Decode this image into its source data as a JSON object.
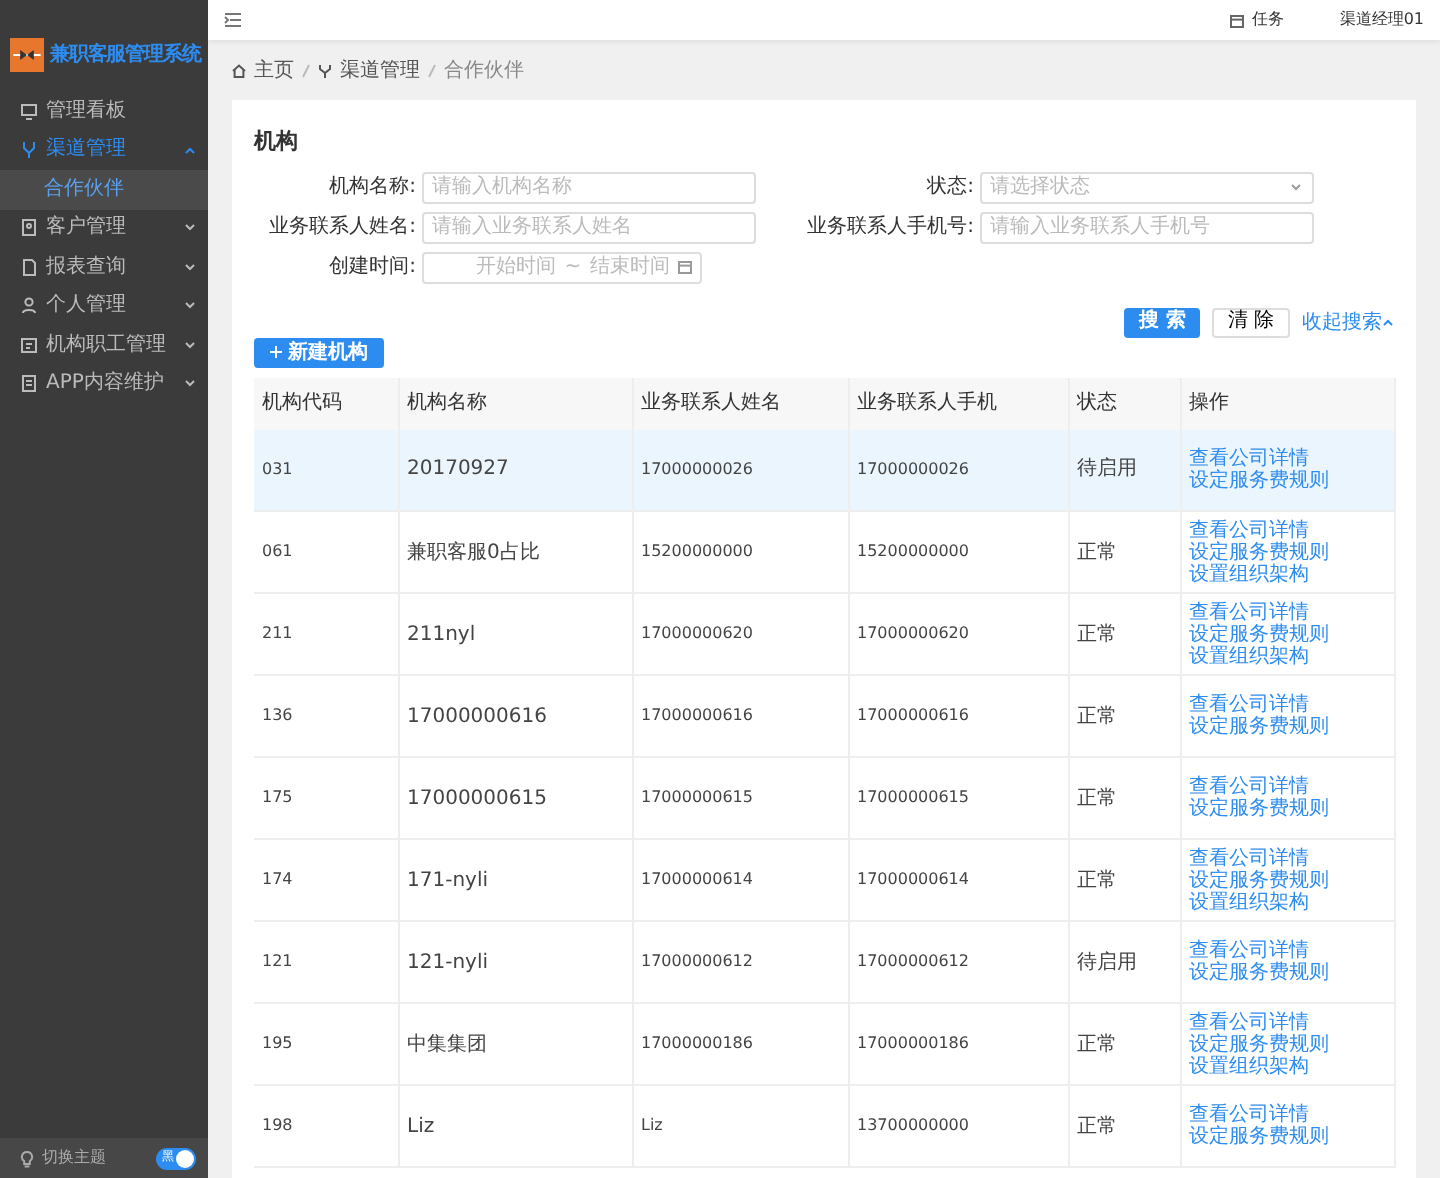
{
  "app": {
    "title": "兼职客服管理系统"
  },
  "sidebar": {
    "items": [
      {
        "label": "管理看板",
        "kind": "link",
        "selected": false
      },
      {
        "label": "渠道管理",
        "kind": "group",
        "expanded": true,
        "selected": true,
        "children": [
          {
            "label": "合作伙伴",
            "selected": true
          }
        ]
      },
      {
        "label": "客户管理",
        "kind": "group",
        "expanded": false,
        "selected": false
      },
      {
        "label": "报表查询",
        "kind": "group",
        "expanded": false,
        "selected": false
      },
      {
        "label": "个人管理",
        "kind": "group",
        "expanded": false,
        "selected": false
      },
      {
        "label": "机构职工管理",
        "kind": "group",
        "expanded": false,
        "selected": false
      },
      {
        "label": "APP内容维护",
        "kind": "group",
        "expanded": false,
        "selected": false
      }
    ],
    "theme_switch": {
      "label": "切换主题",
      "switch_text": "黑",
      "on": true
    }
  },
  "topbar": {
    "task": "任务",
    "user": "渠道经理01"
  },
  "breadcrumb": [
    "主页",
    "渠道管理",
    "合作伙伴"
  ],
  "page_title": "机构",
  "form": {
    "fields": [
      {
        "label": "机构名称:",
        "kind": "input",
        "placeholder": "请输入机构名称"
      },
      {
        "label": "状态:",
        "kind": "select",
        "placeholder": "请选择状态"
      },
      {
        "label": "业务联系人姓名:",
        "kind": "input",
        "placeholder": "请输入业务联系人姓名"
      },
      {
        "label": "业务联系人手机号:",
        "kind": "input",
        "placeholder": "请输入业务联系人手机号"
      },
      {
        "label": "创建时间:",
        "kind": "daterange",
        "start_placeholder": "开始时间",
        "separator": "~",
        "end_placeholder": "结束时间"
      }
    ],
    "buttons": {
      "search": "搜 索",
      "clear": "清 除",
      "collapse": "收起搜索"
    }
  },
  "new_button": "新建机构",
  "table": {
    "columns": [
      "机构代码",
      "机构名称",
      "业务联系人姓名",
      "业务联系人手机",
      "状态",
      "操作"
    ],
    "rows": [
      {
        "cells": [
          "031",
          "20170927",
          "17000000026",
          "17000000026",
          "待启用"
        ],
        "actions": [
          "查看公司详情",
          "设定服务费规则"
        ],
        "selected": true
      },
      {
        "cells": [
          "061",
          "兼职客服0占比",
          "15200000000",
          "15200000000",
          "正常"
        ],
        "actions": [
          "查看公司详情",
          "设定服务费规则",
          "设置组织架构"
        ],
        "selected": false
      },
      {
        "cells": [
          "211",
          "211nyl",
          "17000000620",
          "17000000620",
          "正常"
        ],
        "actions": [
          "查看公司详情",
          "设定服务费规则",
          "设置组织架构"
        ],
        "selected": false
      },
      {
        "cells": [
          "136",
          "17000000616",
          "17000000616",
          "17000000616",
          "正常"
        ],
        "actions": [
          "查看公司详情",
          "设定服务费规则"
        ],
        "selected": false
      },
      {
        "cells": [
          "175",
          "17000000615",
          "17000000615",
          "17000000615",
          "正常"
        ],
        "actions": [
          "查看公司详情",
          "设定服务费规则"
        ],
        "selected": false
      },
      {
        "cells": [
          "174",
          "171-nyli",
          "17000000614",
          "17000000614",
          "正常"
        ],
        "actions": [
          "查看公司详情",
          "设定服务费规则",
          "设置组织架构"
        ],
        "selected": false
      },
      {
        "cells": [
          "121",
          "121-nyli",
          "17000000612",
          "17000000612",
          "待启用"
        ],
        "actions": [
          "查看公司详情",
          "设定服务费规则"
        ],
        "selected": false
      },
      {
        "cells": [
          "195",
          "中集集团",
          "17000000186",
          "17000000186",
          "正常"
        ],
        "actions": [
          "查看公司详情",
          "设定服务费规则",
          "设置组织架构"
        ],
        "selected": false
      },
      {
        "cells": [
          "198",
          "Liz",
          "Liz",
          "13700000000",
          "正常"
        ],
        "actions": [
          "查看公司详情",
          "设定服务费规则"
        ],
        "selected": false
      }
    ]
  }
}
